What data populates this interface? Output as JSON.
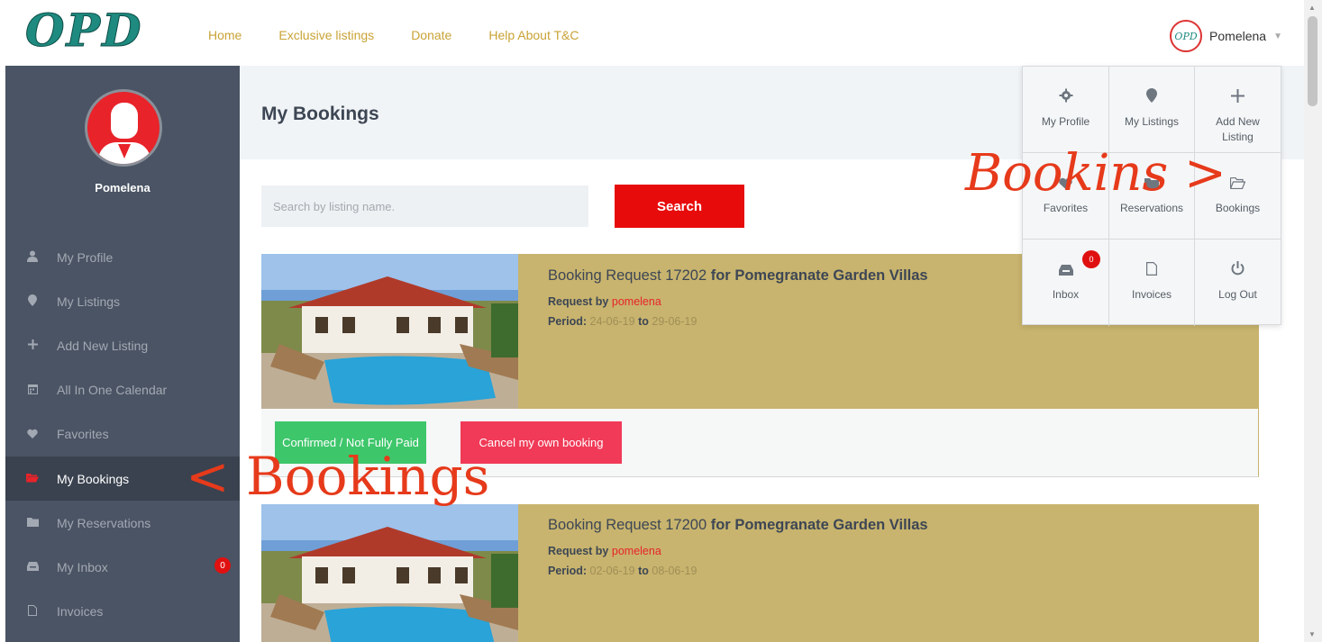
{
  "brand": {
    "logo_text": "OPD"
  },
  "nav": [
    {
      "label": "Home"
    },
    {
      "label": "Exclusive listings"
    },
    {
      "label": "Donate"
    },
    {
      "label": "Help About T&C"
    }
  ],
  "user": {
    "avatar_text": "OPD",
    "name": "Pomelena"
  },
  "sidebar": {
    "username": "Pomelena",
    "items": [
      {
        "label": "My Profile",
        "icon": "user-icon"
      },
      {
        "label": "My Listings",
        "icon": "map-pin-icon"
      },
      {
        "label": "Add New Listing",
        "icon": "plus-icon"
      },
      {
        "label": "All In One Calendar",
        "icon": "calendar-icon"
      },
      {
        "label": "Favorites",
        "icon": "heart-icon"
      },
      {
        "label": "My Bookings",
        "icon": "folder-open-icon",
        "active": true
      },
      {
        "label": "My Reservations",
        "icon": "folder-icon"
      },
      {
        "label": "My Inbox",
        "icon": "inbox-icon",
        "badge": "0"
      },
      {
        "label": "Invoices",
        "icon": "file-icon"
      }
    ]
  },
  "page": {
    "title": "My Bookings"
  },
  "search": {
    "placeholder": "Search by listing name.",
    "button_label": "Search"
  },
  "bookings": [
    {
      "title_prefix": "Booking Request 17202",
      "title_suffix": "for Pomegranate Garden Villas",
      "request_label": "Request by",
      "requester": "pomelena",
      "period_label": "Period:",
      "from": "24-06-19",
      "to_label": "to",
      "to": "29-06-19"
    },
    {
      "title_prefix": "Booking Request 17200",
      "title_suffix": "for Pomegranate Garden Villas",
      "request_label": "Request by",
      "requester": "pomelena",
      "period_label": "Period:",
      "from": "02-06-19",
      "to_label": "to",
      "to": "08-06-19"
    }
  ],
  "actions": {
    "status_label": "Confirmed / Not Fully Paid",
    "cancel_label": "Cancel my own booking"
  },
  "dropdown": {
    "items": [
      {
        "label": "My Profile",
        "icon": "gear-icon"
      },
      {
        "label": "My Listings",
        "icon": "map-pin-icon"
      },
      {
        "label": "Add New Listing",
        "icon": "plus-icon"
      },
      {
        "label": "Favorites",
        "icon": "heart-icon"
      },
      {
        "label": "Reservations",
        "icon": "folder-icon"
      },
      {
        "label": "Bookings",
        "icon": "folder-open-icon"
      },
      {
        "label": "Inbox",
        "icon": "inbox-icon",
        "badge": "0"
      },
      {
        "label": "Invoices",
        "icon": "file-icon"
      },
      {
        "label": "Log Out",
        "icon": "power-icon"
      }
    ]
  },
  "annotations": {
    "dropdown_note": "Bookins >",
    "sidebar_note": "< Bookings"
  },
  "colors": {
    "accent_red": "#e70b0b",
    "card_gold": "#c8b46e",
    "sidebar": "#4a5464",
    "confirm_green": "#3ec66b",
    "cancel_pink": "#f03a57",
    "nav_gold": "#c9a336"
  }
}
